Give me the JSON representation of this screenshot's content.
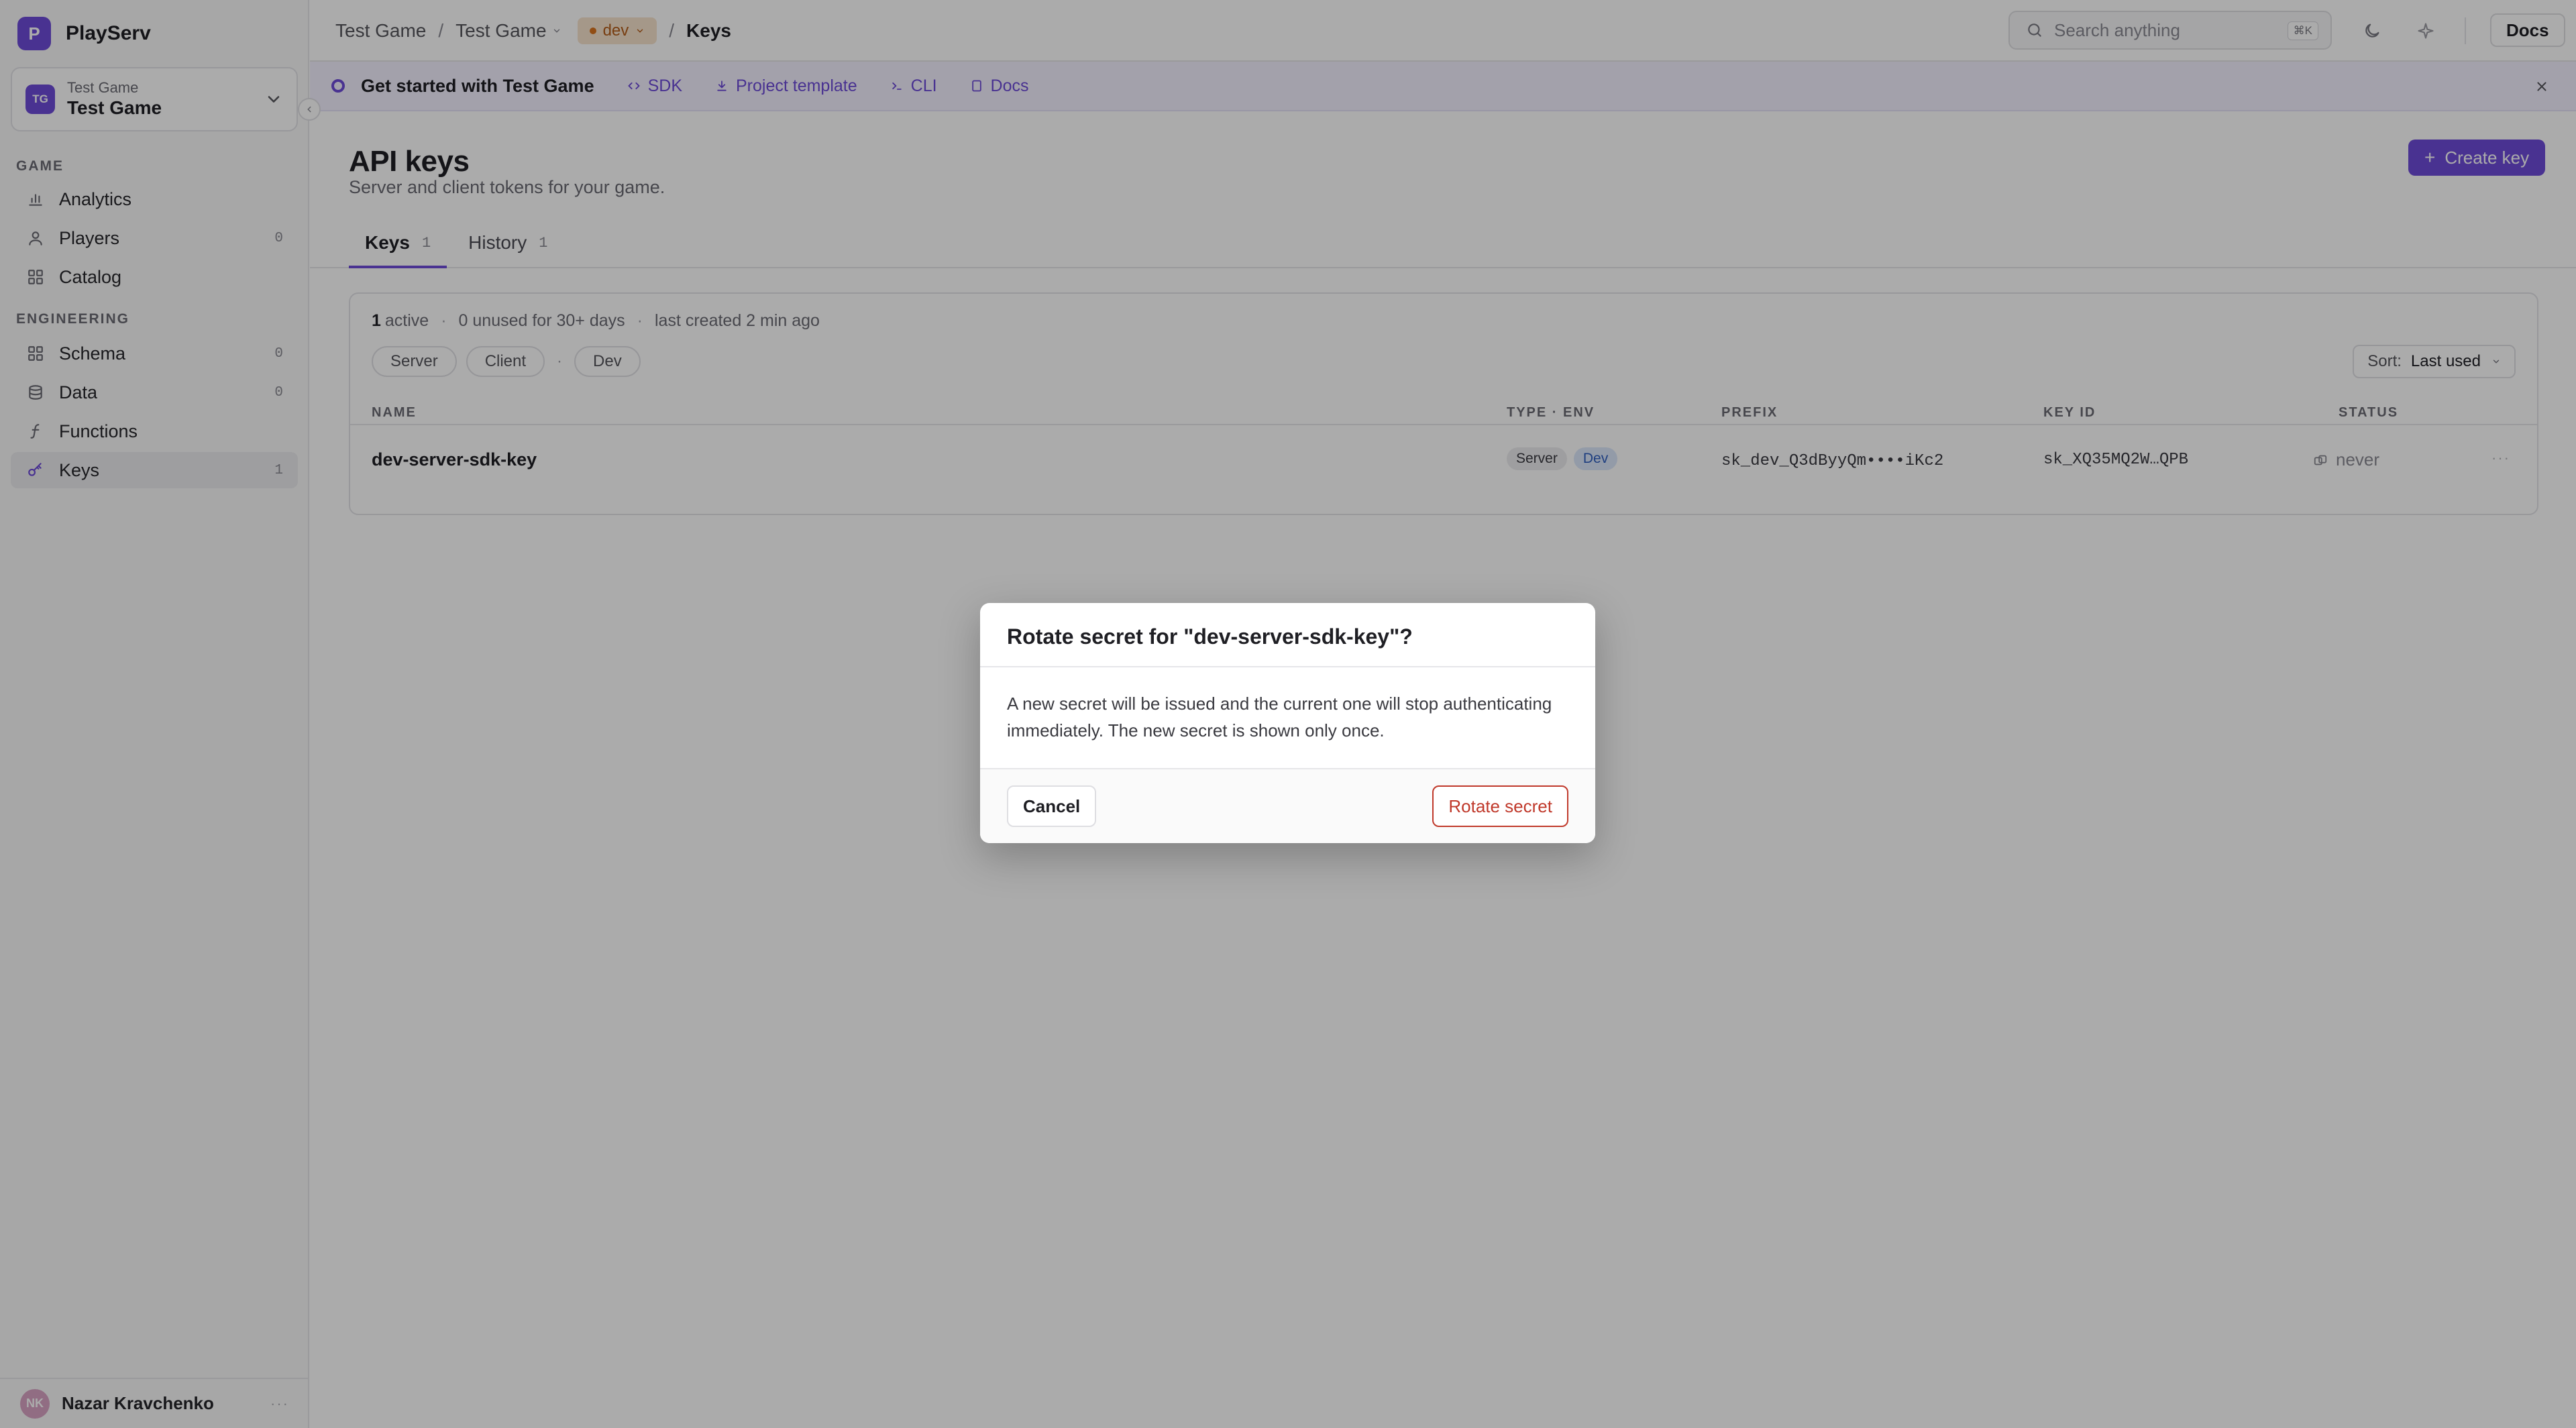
{
  "brand": {
    "logo_letter": "P",
    "name": "PlayServ",
    "accent": "#6d4bd8"
  },
  "project": {
    "avatar": "TG",
    "subtitle": "Test Game",
    "title": "Test Game"
  },
  "sidebar": {
    "sections": [
      {
        "label": "GAME"
      },
      {
        "label": "ENGINEERING"
      }
    ],
    "items": [
      {
        "label": "Analytics",
        "icon": "bar-chart-icon",
        "count": ""
      },
      {
        "label": "Players",
        "icon": "user-icon",
        "count": "0"
      },
      {
        "label": "Catalog",
        "icon": "grid-icon",
        "count": ""
      },
      {
        "label": "Schema",
        "icon": "grid-icon",
        "count": "0"
      },
      {
        "label": "Data",
        "icon": "database-icon",
        "count": "0"
      },
      {
        "label": "Functions",
        "icon": "function-icon",
        "count": ""
      },
      {
        "label": "Keys",
        "icon": "key-icon",
        "count": "1",
        "active": true
      }
    ]
  },
  "user": {
    "initials": "NK",
    "name": "Nazar Kravchenko",
    "more": "···"
  },
  "breadcrumbs": {
    "items": [
      "Test Game",
      "Test Game"
    ],
    "separator": "/",
    "env": "dev",
    "current": "Keys"
  },
  "search": {
    "placeholder": "Search anything",
    "shortcut": "⌘K"
  },
  "topbar": {
    "docs_label": "Docs"
  },
  "banner": {
    "title": "Get started with Test Game",
    "links": [
      "SDK",
      "Project template",
      "CLI",
      "Docs"
    ],
    "bg_color": "#f3f0ff"
  },
  "page": {
    "title": "API keys",
    "subtitle": "Server and client tokens for your game.",
    "create_label": "Create key"
  },
  "tabs": [
    {
      "label": "Keys",
      "count": "1",
      "active": true
    },
    {
      "label": "History",
      "count": "1",
      "active": false
    }
  ],
  "summary": {
    "active_count": "1",
    "active_label": "active",
    "unused": "0 unused for 30+ days",
    "last_created": "last created 2 min ago",
    "separator": "·"
  },
  "filters": {
    "chips": [
      "Server",
      "Client",
      "Dev"
    ],
    "separator": "·"
  },
  "sort": {
    "label": "Sort:",
    "value": "Last used"
  },
  "table": {
    "columns": [
      "NAME",
      "TYPE · ENV",
      "PREFIX",
      "KEY ID",
      "STATUS"
    ],
    "rows": [
      {
        "name": "dev-server-sdk-key",
        "type": "Server",
        "env": "Dev",
        "prefix": "sk_dev_Q3dByyQm••••iKc2",
        "key_id": "sk_XQ35MQ2W…QPB",
        "status": "never",
        "more": "···"
      }
    ]
  },
  "dialog": {
    "title": "Rotate secret for \"dev-server-sdk-key\"?",
    "body": "A new secret will be issued and the current one will stop authenticating immediately. The new secret is shown only once.",
    "cancel_label": "Cancel",
    "confirm_label": "Rotate secret",
    "danger_color": "#c0392b"
  }
}
